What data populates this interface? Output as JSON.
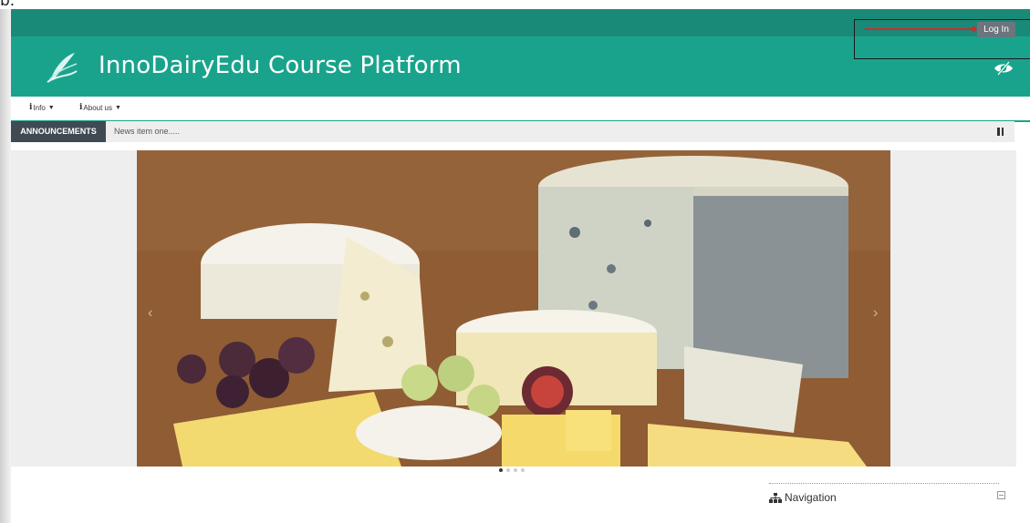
{
  "caption": {
    "fragment": "b."
  },
  "header": {
    "title": "InnoDairyEdu Course Platform",
    "login_label": "Log In",
    "logo_icon": "leaf-logo-icon",
    "accessibility_icon": "eye-slash-icon"
  },
  "nav": {
    "items": [
      {
        "label": "Info",
        "icon": "info-icon"
      },
      {
        "label": "About us",
        "icon": "info-icon"
      }
    ]
  },
  "announcements": {
    "label": "ANNOUNCEMENTS",
    "text": "News item one.....",
    "pause_icon": "pause-icon"
  },
  "carousel": {
    "slides_total": 4,
    "active_slide": 1
  },
  "block": {
    "title": "Navigation",
    "icon": "sitemap-icon"
  },
  "colors": {
    "brand": "#1aa38c",
    "topbar": "#1a8a78",
    "annotation": "#d7262b"
  }
}
